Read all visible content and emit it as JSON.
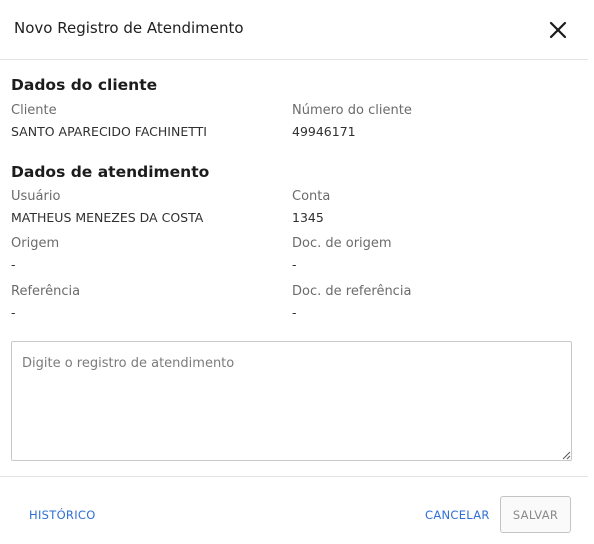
{
  "dialog": {
    "title": "Novo Registro de Atendimento",
    "close_icon": "close-icon"
  },
  "client_section": {
    "title": "Dados do cliente",
    "client_label": "Cliente",
    "client_value": "SANTO APARECIDO FACHINETTI",
    "client_number_label": "Número do cliente",
    "client_number_value": "49946171"
  },
  "service_section": {
    "title": "Dados de atendimento",
    "user_label": "Usuário",
    "user_value": "MATHEUS MENEZES DA COSTA",
    "account_label": "Conta",
    "account_value": "1345",
    "origin_label": "Origem",
    "origin_value": "-",
    "origin_doc_label": "Doc. de origem",
    "origin_doc_value": "-",
    "reference_label": "Referência",
    "reference_value": "-",
    "reference_doc_label": "Doc. de referência",
    "reference_doc_value": "-"
  },
  "record_input": {
    "placeholder": "Digite o registro de atendimento",
    "value": ""
  },
  "footer": {
    "history_label": "HISTÓRICO",
    "cancel_label": "CANCELAR",
    "save_label": "SALVAR"
  },
  "colors": {
    "link": "#2f6fd6",
    "disabled_text": "#8a8a8a"
  }
}
